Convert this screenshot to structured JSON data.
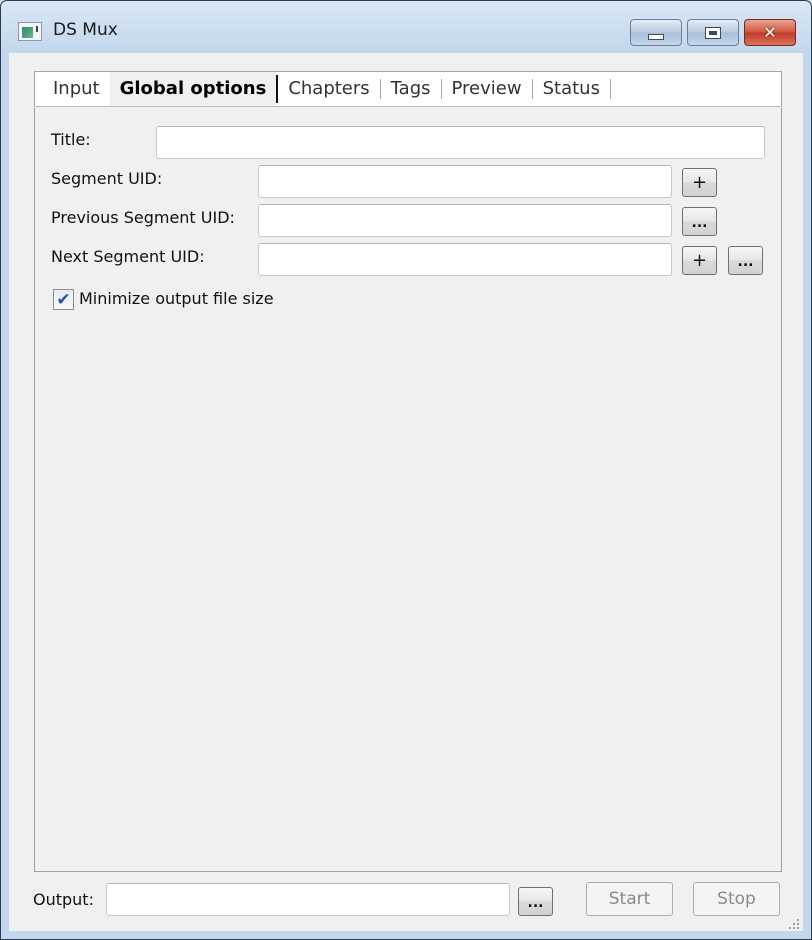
{
  "window": {
    "title": "DS Mux",
    "icon": "app-window-icon",
    "controls": {
      "minimize_icon": "minimize-icon",
      "maximize_icon": "maximize-icon",
      "close_glyph": "✕"
    }
  },
  "tabs": [
    {
      "label": "Input",
      "active": false
    },
    {
      "label": "Global options",
      "active": true
    },
    {
      "label": "Chapters",
      "active": false
    },
    {
      "label": "Tags",
      "active": false
    },
    {
      "label": "Preview",
      "active": false
    },
    {
      "label": "Status",
      "active": false
    }
  ],
  "global_options": {
    "title": {
      "label": "Title:",
      "value": ""
    },
    "segment_uid": {
      "label": "Segment UID:",
      "value": "",
      "add_button": "+"
    },
    "previous_segment_uid": {
      "label": "Previous Segment UID:",
      "value": "",
      "browse_button": "..."
    },
    "next_segment_uid": {
      "label": "Next Segment UID:",
      "value": "",
      "add_button": "+",
      "browse_button": "..."
    },
    "minimize_output": {
      "label": "Minimize output file size",
      "checked": true,
      "check_glyph": "✔"
    }
  },
  "footer": {
    "output_label": "Output:",
    "output_value": "",
    "browse_button": "...",
    "start_button": "Start",
    "stop_button": "Stop",
    "start_enabled": false,
    "stop_enabled": false
  }
}
